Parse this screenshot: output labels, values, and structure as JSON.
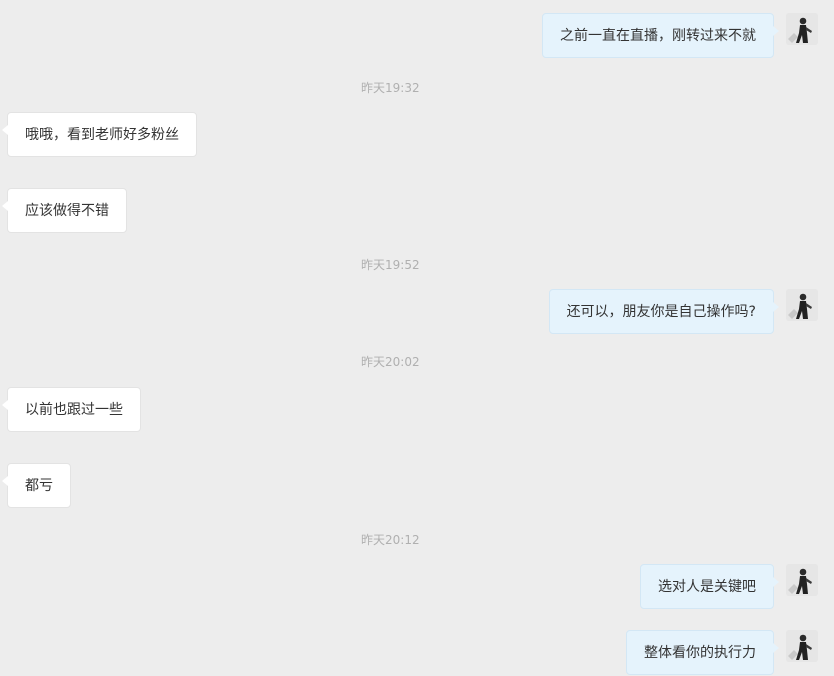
{
  "messages": [
    {
      "type": "out",
      "text": "之前一直在直播，刚转过来不就"
    },
    {
      "type": "time",
      "text": "昨天19:32"
    },
    {
      "type": "in",
      "text": "哦哦，看到老师好多粉丝"
    },
    {
      "type": "in",
      "text": "应该做得不错"
    },
    {
      "type": "time",
      "text": "昨天19:52"
    },
    {
      "type": "out",
      "text": "还可以，朋友你是自己操作吗?"
    },
    {
      "type": "time",
      "text": "昨天20:02"
    },
    {
      "type": "in",
      "text": "以前也跟过一些"
    },
    {
      "type": "in",
      "text": "都亏"
    },
    {
      "type": "time",
      "text": "昨天20:12"
    },
    {
      "type": "out",
      "text": "选对人是关键吧"
    },
    {
      "type": "out",
      "text": "整体看你的执行力"
    }
  ]
}
